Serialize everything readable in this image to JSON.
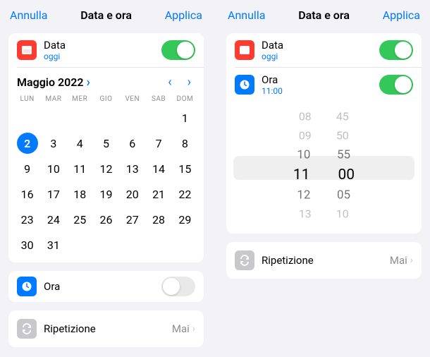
{
  "left": {
    "header": {
      "cancel": "Annulla",
      "title": "Data e ora",
      "apply": "Applica"
    },
    "data_row": {
      "label": "Data",
      "sub": "oggi"
    },
    "month_label": "Maggio 2022",
    "weekdays": [
      "LUN",
      "MAR",
      "MER",
      "GIO",
      "VEN",
      "SAB",
      "DOM"
    ],
    "selected_day": 2,
    "days_in_month": 31,
    "first_weekday_index": 6,
    "ora_row": {
      "label": "Ora"
    },
    "repeat": {
      "label": "Ripetizione",
      "value": "Mai"
    }
  },
  "right": {
    "header": {
      "cancel": "Annulla",
      "title": "Data e ora",
      "apply": "Applica"
    },
    "data_row": {
      "label": "Data",
      "sub": "oggi"
    },
    "ora_row": {
      "label": "Ora",
      "sub": "11:00"
    },
    "picker": {
      "hours": [
        "08",
        "09",
        "10",
        "11",
        "12",
        "13"
      ],
      "minutes": [
        "45",
        "50",
        "55",
        "00",
        "05",
        "10"
      ],
      "selected_index": 3
    },
    "repeat": {
      "label": "Ripetizione",
      "value": "Mai"
    }
  }
}
